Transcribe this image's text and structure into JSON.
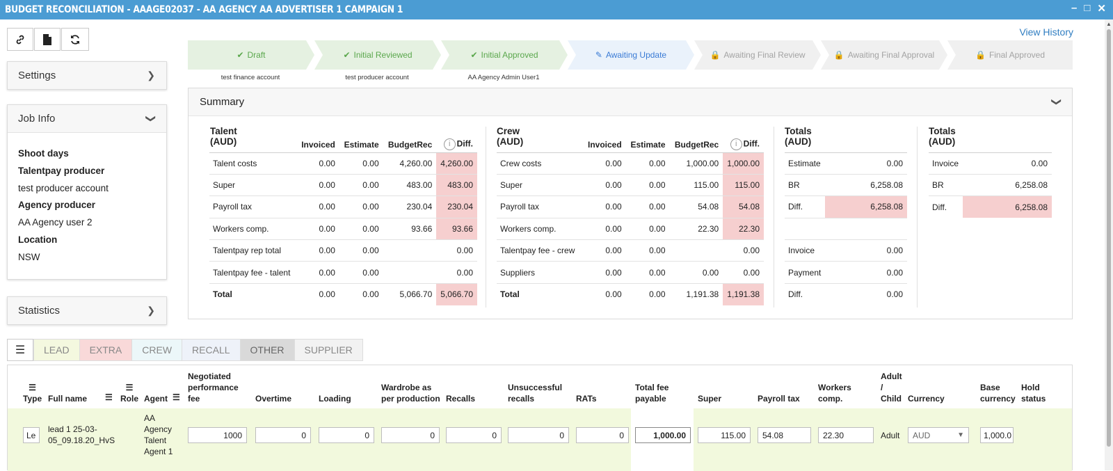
{
  "window": {
    "title": "BUDGET RECONCILIATION - AAAGE02037 - AA AGENCY AA ADVERTISER 1 CAMPAIGN 1",
    "minimize": "–",
    "maximize": "□",
    "close": "✕"
  },
  "toolbar": {
    "link_icon": "link-icon",
    "file_icon": "file-icon",
    "refresh_icon": "refresh-icon"
  },
  "sidebar": {
    "settings": "Settings",
    "job_info": "Job Info",
    "statistics": "Statistics",
    "job_fields": [
      {
        "label": "Shoot days",
        "value": ""
      },
      {
        "label": "Talentpay producer",
        "value": "test producer account"
      },
      {
        "label": "Agency producer",
        "value": "AA Agency user 2"
      },
      {
        "label": "Location",
        "value": "NSW"
      }
    ]
  },
  "view_history": "View History",
  "workflow": {
    "steps": [
      {
        "label": "Draft",
        "state": "done",
        "by": "test finance account"
      },
      {
        "label": "Initial Reviewed",
        "state": "done",
        "by": "test producer account"
      },
      {
        "label": "Initial Approved",
        "state": "done",
        "by": "AA Agency Admin User1"
      },
      {
        "label": "Awaiting Update",
        "state": "active",
        "by": ""
      },
      {
        "label": "Awaiting Final Review",
        "state": "locked",
        "by": ""
      },
      {
        "label": "Awaiting Final Approval",
        "state": "locked",
        "by": ""
      },
      {
        "label": "Final Approved",
        "state": "locked",
        "by": ""
      }
    ]
  },
  "summary": {
    "title": "Summary",
    "talent": {
      "title": "Talent (AUD)",
      "headers": [
        "Invoiced",
        "Estimate",
        "BudgetRec",
        "Diff."
      ],
      "rows": [
        {
          "label": "Talent costs",
          "invoiced": "0.00",
          "estimate": "0.00",
          "budgetrec": "4,260.00",
          "diff": "4,260.00",
          "pink": true
        },
        {
          "label": "Super",
          "invoiced": "0.00",
          "estimate": "0.00",
          "budgetrec": "483.00",
          "diff": "483.00",
          "pink": true
        },
        {
          "label": "Payroll tax",
          "invoiced": "0.00",
          "estimate": "0.00",
          "budgetrec": "230.04",
          "diff": "230.04",
          "pink": true
        },
        {
          "label": "Workers comp.",
          "invoiced": "0.00",
          "estimate": "0.00",
          "budgetrec": "93.66",
          "diff": "93.66",
          "pink": true
        },
        {
          "label": "Talentpay rep total",
          "invoiced": "0.00",
          "estimate": "0.00",
          "budgetrec": "",
          "diff": "0.00",
          "pink": false
        },
        {
          "label": "Talentpay fee - talent",
          "invoiced": "0.00",
          "estimate": "0.00",
          "budgetrec": "",
          "diff": "0.00",
          "pink": false
        },
        {
          "label": "Total",
          "invoiced": "0.00",
          "estimate": "0.00",
          "budgetrec": "5,066.70",
          "diff": "5,066.70",
          "pink": true,
          "bold": true
        }
      ]
    },
    "crew": {
      "title": "Crew (AUD)",
      "headers": [
        "Invoiced",
        "Estimate",
        "BudgetRec",
        "Diff."
      ],
      "rows": [
        {
          "label": "Crew costs",
          "invoiced": "0.00",
          "estimate": "0.00",
          "budgetrec": "1,000.00",
          "diff": "1,000.00",
          "pink": true
        },
        {
          "label": "Super",
          "invoiced": "0.00",
          "estimate": "0.00",
          "budgetrec": "115.00",
          "diff": "115.00",
          "pink": true
        },
        {
          "label": "Payroll tax",
          "invoiced": "0.00",
          "estimate": "0.00",
          "budgetrec": "54.08",
          "diff": "54.08",
          "pink": true
        },
        {
          "label": "Workers comp.",
          "invoiced": "0.00",
          "estimate": "0.00",
          "budgetrec": "22.30",
          "diff": "22.30",
          "pink": true
        },
        {
          "label": "Talentpay fee - crew",
          "invoiced": "0.00",
          "estimate": "0.00",
          "budgetrec": "",
          "diff": "0.00",
          "pink": false
        },
        {
          "label": "Suppliers",
          "invoiced": "0.00",
          "estimate": "0.00",
          "budgetrec": "0.00",
          "diff": "0.00",
          "pink": false
        },
        {
          "label": "Total",
          "invoiced": "0.00",
          "estimate": "0.00",
          "budgetrec": "1,191.38",
          "diff": "1,191.38",
          "pink": true,
          "bold": true
        }
      ]
    },
    "totals_estimate": {
      "title": "Totals (AUD)",
      "rows": [
        {
          "label": "Estimate",
          "value": "0.00",
          "pink": false
        },
        {
          "label": "BR",
          "value": "6,258.08",
          "pink": false
        },
        {
          "label": "Diff.",
          "value": "6,258.08",
          "pink": true
        },
        {
          "label": "",
          "value": "",
          "pink": false
        },
        {
          "label": "Invoice",
          "value": "0.00",
          "pink": false
        },
        {
          "label": "Payment",
          "value": "0.00",
          "pink": false
        },
        {
          "label": "Diff.",
          "value": "0.00",
          "pink": false
        }
      ]
    },
    "totals_invoice": {
      "title": "Totals (AUD)",
      "rows": [
        {
          "label": "Invoice",
          "value": "0.00",
          "pink": false
        },
        {
          "label": "BR",
          "value": "6,258.08",
          "pink": false
        },
        {
          "label": "Diff.",
          "value": "6,258.08",
          "pink": true
        }
      ]
    }
  },
  "tabs": [
    "LEAD",
    "EXTRA",
    "CREW",
    "RECALL",
    "OTHER",
    "SUPPLIER"
  ],
  "grid": {
    "headers": {
      "type": "Type",
      "fullname": "Full name",
      "role": "Role",
      "agent": "Agent",
      "negotiated": "Negotiated performance fee",
      "overtime": "Overtime",
      "loading": "Loading",
      "wardrobe": "Wardrobe as per production",
      "recalls": "Recalls",
      "unsuccessful": "Unsuccessful recalls",
      "rats": "RATs",
      "totalfee": "Total fee payable",
      "super": "Super",
      "payroll": "Payroll tax",
      "workers": "Workers comp.",
      "adultchild": "Adult / Child",
      "currency": "Currency",
      "base": "Base currency",
      "hold": "Hold status"
    },
    "row": {
      "type": "Le",
      "fullname": "lead 1 25-03-05_09.18.20_HvS",
      "agent": "AA Agency Talent Agent 1",
      "negotiated": "1000",
      "overtime": "0",
      "loading": "0",
      "wardrobe": "0",
      "recalls": "0",
      "unsuccessful": "0",
      "rats": "0",
      "totalfee": "1,000.00",
      "super": "115.00",
      "payroll": "54.08",
      "workers": "22.30",
      "adultchild": "Adult",
      "currency": "AUD",
      "base": "1,000.0"
    }
  },
  "colors": {
    "titlebar": "#4b9cd3",
    "done": "#5aa74c",
    "active": "#3a7bd5",
    "pink": "#f6cfcf",
    "row": "#f2f9dd"
  }
}
